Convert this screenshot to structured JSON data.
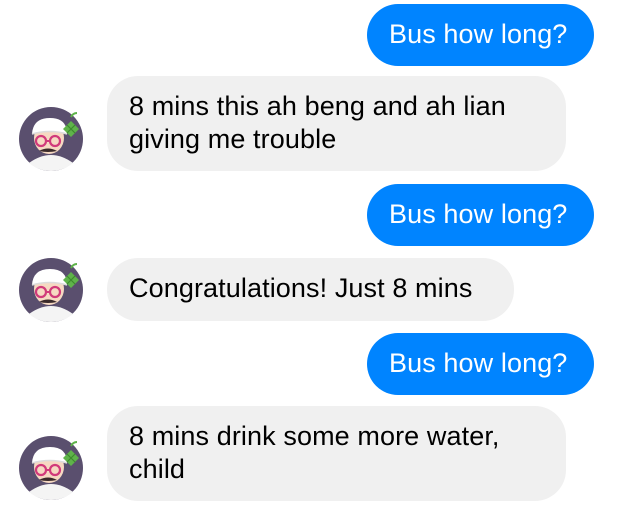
{
  "messages": [
    {
      "direction": "outgoing",
      "text": "Bus how long?"
    },
    {
      "direction": "incoming",
      "text": "8 mins this ah beng and ah lian\ngiving me trouble",
      "avatar": "bot-avatar-icon"
    },
    {
      "direction": "outgoing",
      "text": "Bus how long?"
    },
    {
      "direction": "incoming",
      "text": "Congratulations! Just 8 mins",
      "avatar": "bot-avatar-icon"
    },
    {
      "direction": "outgoing",
      "text": "Bus how long?"
    },
    {
      "direction": "incoming",
      "text": "8 mins drink some more water,\nchild",
      "avatar": "bot-avatar-icon"
    }
  ],
  "colors": {
    "outgoing_bubble": "#0084ff",
    "incoming_bubble": "#f0f0f0",
    "avatar_bg": "#5a4f6e"
  }
}
